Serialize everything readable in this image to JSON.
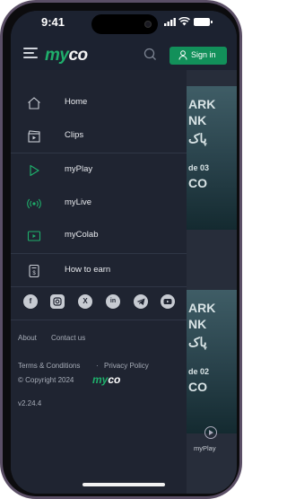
{
  "status_bar": {
    "time": "9:41"
  },
  "header": {
    "logo_my": "my",
    "logo_co": "co",
    "sign_in_label": "Sign in",
    "accent_color": "#12905a"
  },
  "menu": {
    "items": [
      {
        "label": "Home",
        "icon": "home-icon"
      },
      {
        "label": "Clips",
        "icon": "clapperboard-icon"
      },
      {
        "label": "myPlay",
        "icon": "play-icon"
      },
      {
        "label": "myLive",
        "icon": "live-broadcast-icon"
      },
      {
        "label": "myColab",
        "icon": "colab-video-icon"
      },
      {
        "label": "How to earn",
        "icon": "earn-wallet-icon"
      }
    ]
  },
  "social": [
    "facebook-icon",
    "instagram-icon",
    "x-icon",
    "linkedin-icon",
    "telegram-icon",
    "youtube-icon"
  ],
  "footer": {
    "about": "About",
    "contact": "Contact us",
    "terms": "Terms & Conditions",
    "separator": "·",
    "privacy": "Privacy Policy",
    "copyright": "© Copyright 2024",
    "logo_my": "my",
    "logo_co": "co",
    "version": "v2.24.4"
  },
  "background": {
    "card1": {
      "line1": "ARK",
      "line2": "NK",
      "line3": "پاک",
      "episode": "de 03",
      "brand": "CO"
    },
    "card2": {
      "line1": "ARK",
      "line2": "NK",
      "line3": "پاک",
      "episode": "de 02",
      "brand": "CO"
    },
    "tab_label": "myPlay"
  }
}
